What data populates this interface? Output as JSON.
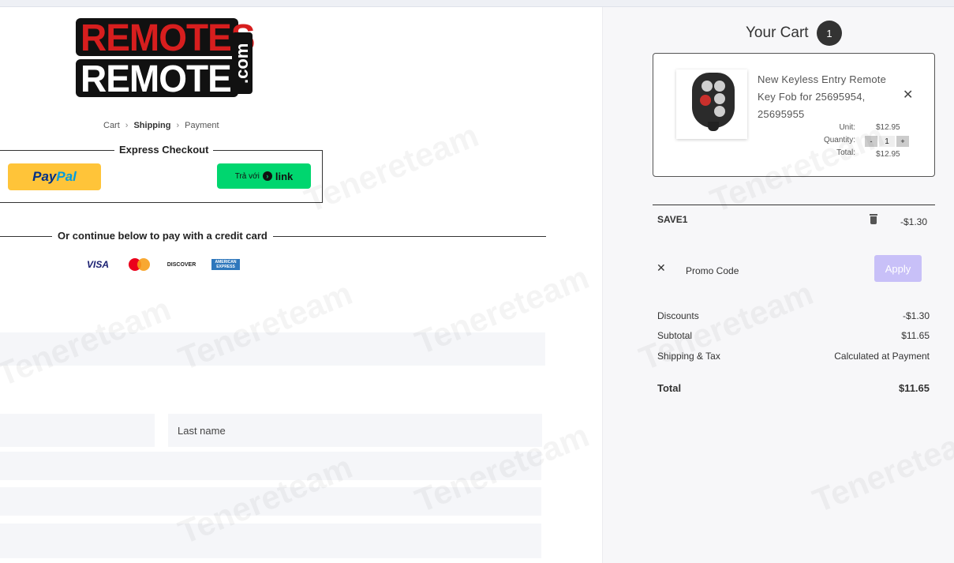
{
  "brand": {
    "logo_top": "REMOTES",
    "logo_bottom": "REMOTES",
    "logo_suffix": ".com",
    "accent_red": "#d71e1e"
  },
  "breadcrumb": {
    "items": [
      "Cart",
      "Shipping",
      "Payment"
    ],
    "active": "Shipping",
    "separator_icon": "chevron-right-icon"
  },
  "express_checkout": {
    "title": "Express Checkout",
    "paypal": {
      "pay": "Pay",
      "pal": "Pal",
      "color": "#ffc439"
    },
    "link": {
      "prefix": "Trả với",
      "label": "link",
      "color": "#00d66f"
    }
  },
  "credit_card": {
    "divider_text": "Or continue below to pay with a credit card",
    "cards": [
      {
        "name": "visa",
        "label": "VISA"
      },
      {
        "name": "mastercard",
        "label": "MasterCard"
      },
      {
        "name": "discover",
        "label": "DISCOVER"
      },
      {
        "name": "amex",
        "label": "AMERICAN EXPRESS"
      }
    ]
  },
  "form": {
    "last_name_placeholder": "Last name"
  },
  "cart": {
    "title": "Your Cart",
    "count": "1",
    "item": {
      "name": "New Keyless Entry Remote Key Fob for 25695954, 25695955",
      "unit_label": "Unit:",
      "unit_price": "$12.95",
      "quantity_label": "Quantity:",
      "quantity": "1",
      "minus": "-",
      "plus": "+",
      "total_label": "Total:",
      "total": "$12.95"
    },
    "promo": {
      "applied_code": "SAVE1",
      "applied_amount": "-$1.30",
      "input_placeholder": "Promo Code",
      "apply_label": "Apply",
      "apply_color": "#c8c0f8"
    },
    "summary": {
      "discounts_label": "Discounts",
      "discounts": "-$1.30",
      "subtotal_label": "Subtotal",
      "subtotal": "$11.65",
      "shipping_label": "Shipping & Tax",
      "shipping": "Calculated at Payment",
      "total_label": "Total",
      "total": "$11.65"
    }
  },
  "watermark": "Tenereteam"
}
